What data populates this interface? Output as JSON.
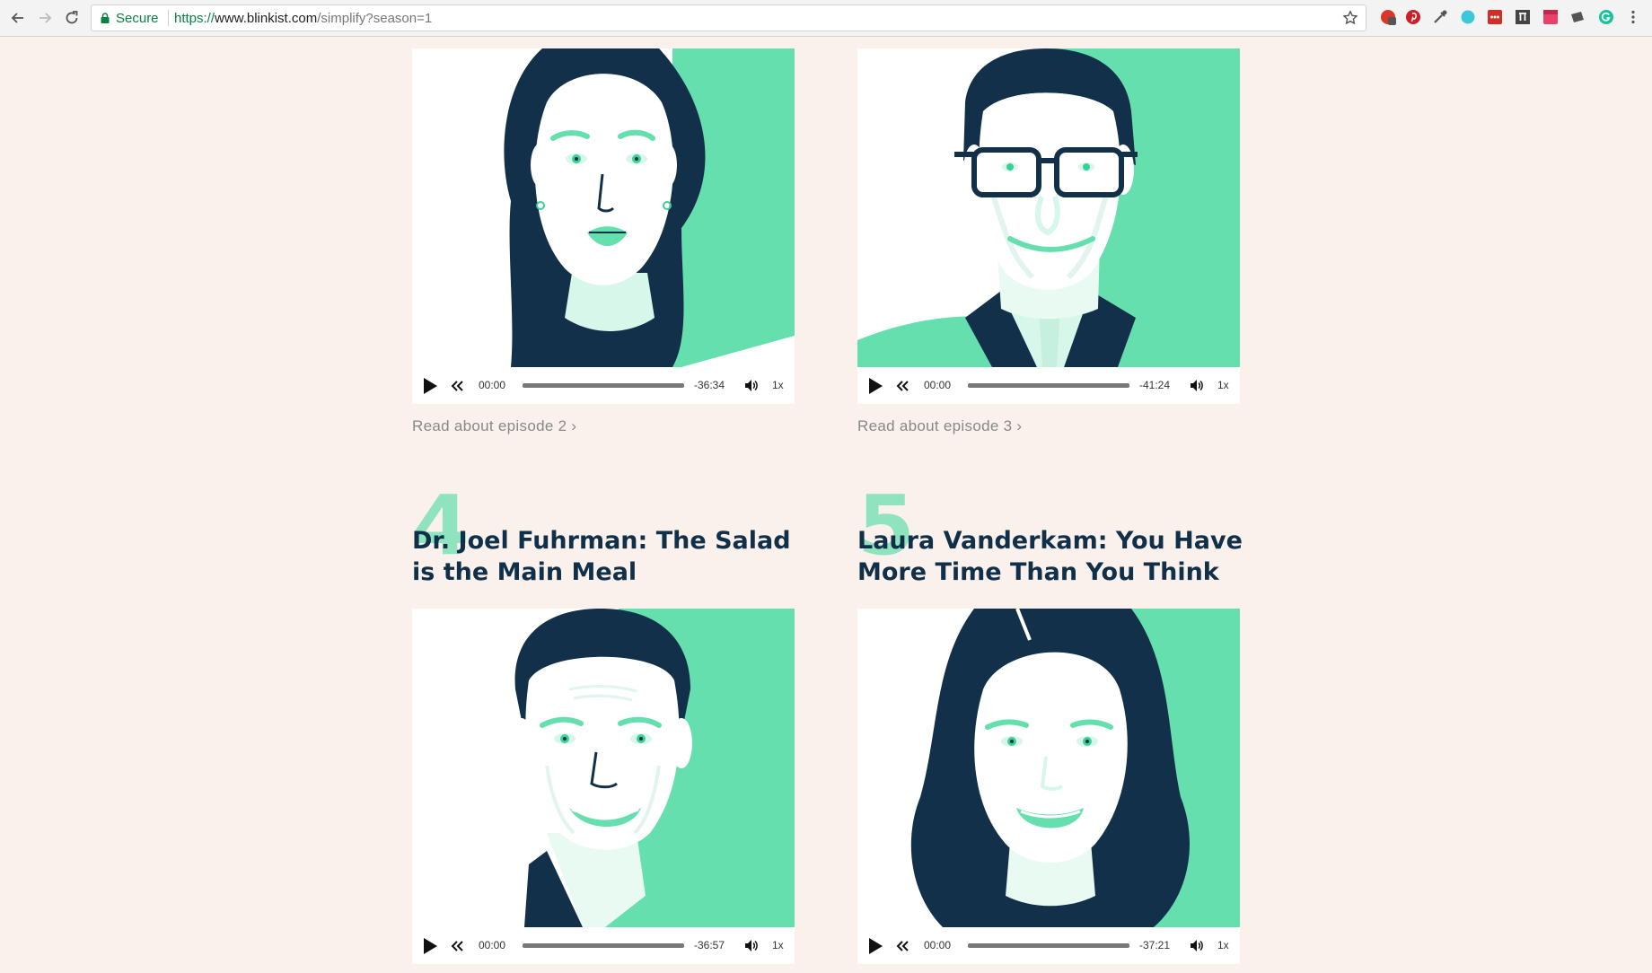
{
  "browser": {
    "secure_label": "Secure",
    "url_scheme": "https://",
    "url_host": "www.blinkist.com",
    "url_path": "/simplify?season=1"
  },
  "colors": {
    "accent_green": "#66dfae",
    "navy": "#12304a",
    "page_bg": "#fbf1ec"
  },
  "episodes": [
    {
      "number": "",
      "title": "",
      "player": {
        "current": "00:00",
        "remaining": "-36:34",
        "speed": "1x",
        "progress": 0
      },
      "read_link": "Read about episode 2 ›"
    },
    {
      "number": "",
      "title": "",
      "player": {
        "current": "00:00",
        "remaining": "-41:24",
        "speed": "1x",
        "progress": 0
      },
      "read_link": "Read about episode 3 ›"
    },
    {
      "number": "4",
      "title": "Dr. Joel Fuhrman: The Salad is the Main Meal",
      "player": {
        "current": "00:00",
        "remaining": "-36:57",
        "speed": "1x",
        "progress": 0
      }
    },
    {
      "number": "5",
      "title": "Laura Vanderkam: You Have More Time Than You Think",
      "player": {
        "current": "00:00",
        "remaining": "-37:21",
        "speed": "1x",
        "progress": 0
      }
    }
  ]
}
